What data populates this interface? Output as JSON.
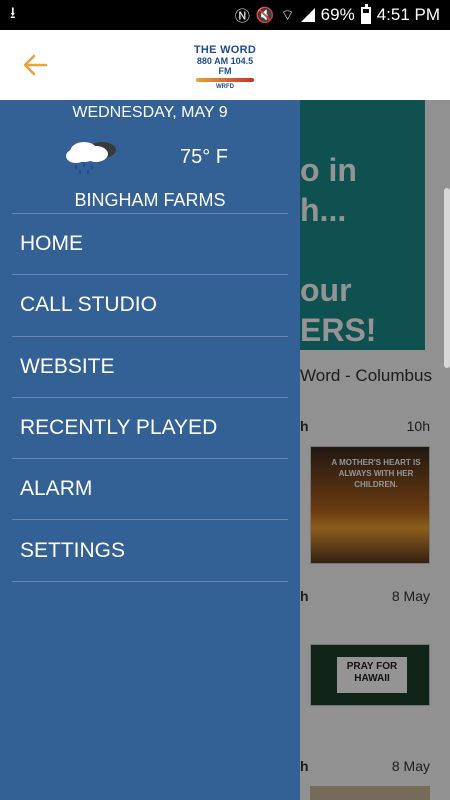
{
  "status_bar": {
    "battery": "69%",
    "battery_level": 0.69,
    "time": "4:51 PM",
    "icons": [
      "download-icon",
      "nfc-icon",
      "mute-icon",
      "wifi-icon",
      "signal-icon",
      "battery-icon"
    ]
  },
  "app_bar": {
    "back_icon": "arrow-left-icon",
    "logo": {
      "line1": "THE WORD",
      "line2": "880 AM 104.5 FM",
      "line3": "WRFD"
    }
  },
  "drawer": {
    "date": "WEDNESDAY, MAY 9",
    "weather_icon": "rain-cloud-icon",
    "temperature": "75° F",
    "city": "BINGHAM FARMS",
    "menu": [
      {
        "label": "HOME"
      },
      {
        "label": "CALL STUDIO"
      },
      {
        "label": "WEBSITE"
      },
      {
        "label": "RECENTLY PLAYED"
      },
      {
        "label": "ALARM"
      },
      {
        "label": "SETTINGS"
      }
    ]
  },
  "background": {
    "banner_fragments": [
      "o in",
      "h...",
      "our",
      "ERS!"
    ],
    "feed_title_fragment": "Word - Columbus",
    "posts": [
      {
        "heading_fragment": "h",
        "time": "10h",
        "image_text": "A MOTHER'S HEART IS ALWAYS WITH HER CHILDREN."
      },
      {
        "heading_fragment": "h",
        "time": "8 May",
        "image_text": "PRAY FOR HAWAII"
      },
      {
        "heading_fragment": "h",
        "time": "8 May",
        "image_text": ""
      }
    ]
  },
  "colors": {
    "drawer": "#336196",
    "accent": "#e8a33b",
    "banner": "#1a8a8a"
  }
}
